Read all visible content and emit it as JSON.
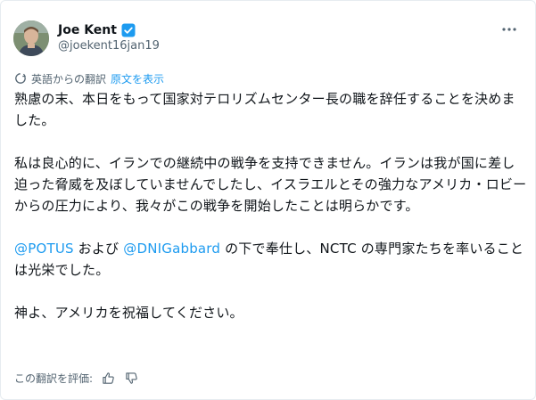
{
  "author": {
    "name": "Joe Kent",
    "handle": "@joekent16jan19"
  },
  "translation": {
    "note": "英語からの翻訳",
    "show_original": "原文を表示"
  },
  "body": {
    "p1": "熟慮の末、本日をもって国家対テロリズムセンター長の職を辞任することを決めました。",
    "p2": "私は良心的に、イランでの継続中の戦争を支持できません。イランは我が国に差し迫った脅威を及ぼしていませんでしたし、イスラエルとその強力なアメリカ・ロビーからの圧力により、我々がこの戦争を開始したことは明らかです。",
    "p3_mention1": "@POTUS",
    "p3_mid": " および ",
    "p3_mention2": "@DNIGabbard",
    "p3_rest": " の下で奉仕し、NCTC の専門家たちを率いることは光栄でした。",
    "p4": "神よ、アメリカを祝福してください。"
  },
  "rating": {
    "label": "この翻訳を評価:"
  },
  "colors": {
    "accent": "#1d9bf0",
    "secondary_text": "#536471",
    "primary_text": "#0f1419"
  },
  "icons": {
    "verified": "verified-badge-icon",
    "more": "more-options-icon",
    "translate": "translate-icon",
    "thumbs_up": "thumbs-up-icon",
    "thumbs_down": "thumbs-down-icon"
  }
}
